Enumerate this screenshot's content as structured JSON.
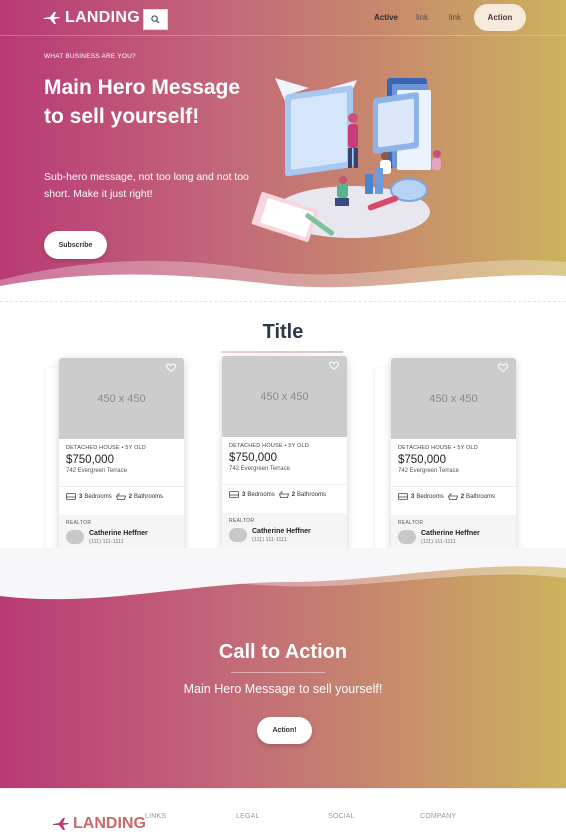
{
  "nav": {
    "logo_text": "LANDING",
    "links": [
      {
        "label": "Active"
      },
      {
        "label": "link"
      },
      {
        "label": "link"
      }
    ],
    "action_label": "Action"
  },
  "hero": {
    "eyebrow": "WHAT BUSINESS ARE YOU?",
    "title": "Main Hero Message to sell yourself!",
    "subtitle": "Sub-hero message, not too long and not too short. Make it just right!",
    "subscribe_label": "Subscribe"
  },
  "listings": {
    "title": "Title",
    "cards": [
      {
        "image_text": "450 x 450",
        "type": "DETACHED HOUSE • 5Y OLD",
        "price": "$750,000",
        "address": "742 Evergreen Terrace",
        "bedrooms_count": "3",
        "bedrooms_label": "Bedrooms",
        "bathrooms_count": "2",
        "bathrooms_label": "Bathrooms",
        "realtor_label": "REALTOR",
        "agent_name": "Catherine Heffner",
        "agent_phone": "(111) 111-1111"
      },
      {
        "image_text": "450 x 450",
        "type": "DETACHED HOUSE • 5Y OLD",
        "price": "$750,000",
        "address": "742 Evergreen Terrace",
        "bedrooms_count": "3",
        "bedrooms_label": "Bedrooms",
        "bathrooms_count": "2",
        "bathrooms_label": "Bathrooms",
        "realtor_label": "REALTOR",
        "agent_name": "Catherine Heffner",
        "agent_phone": "(111) 111-1111"
      },
      {
        "image_text": "450 x 450",
        "type": "DETACHED HOUSE • 5Y OLD",
        "price": "$750,000",
        "address": "742 Evergreen Terrace",
        "bedrooms_count": "3",
        "bedrooms_label": "Bedrooms",
        "bathrooms_count": "2",
        "bathrooms_label": "Bathrooms",
        "realtor_label": "REALTOR",
        "agent_name": "Catherine Heffner",
        "agent_phone": "(111) 111-1111"
      }
    ]
  },
  "cta": {
    "title": "Call to Action",
    "subtitle": "Main Hero Message to sell yourself!",
    "button_label": "Action!"
  },
  "footer": {
    "logo_text": "LANDING",
    "columns": [
      "LINKS",
      "LEGAL",
      "SOCIAL",
      "COMPANY"
    ]
  },
  "colors": {
    "gradient_start": "#b83a74",
    "gradient_end": "#ccb35c",
    "placeholder_gray": "#cccccc"
  }
}
